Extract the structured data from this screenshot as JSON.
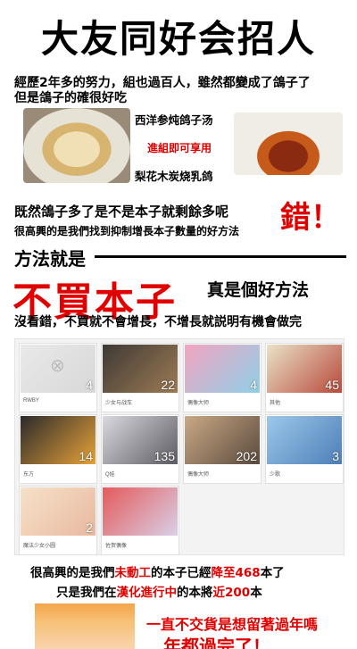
{
  "title": "大友同好会招人",
  "intro": {
    "line1": "經歷2年多的努力，組也過百人，雖然都變成了鴿子了",
    "line2": "但是鴿子的確很好吃"
  },
  "dishes": {
    "dish1": "西洋参炖鸽子汤",
    "offer": "進組即可享用",
    "dish2": "梨花木炭烧乳鸽"
  },
  "question": {
    "line1": "既然鴿子多了是不是本子就剩餘多呢",
    "line2": "很高興的是我們找到抑制增長本子數量的好方法",
    "answer": "錯！"
  },
  "method": {
    "label": "方法就是",
    "big": "不買本子",
    "comment": "真是個好方法"
  },
  "explain": "沒看錯，不買就不會增長，不增長就説明有機會做完",
  "collections": [
    {
      "label": "RWBY",
      "count": "4",
      "color_a": "#e9e9e9",
      "color_b": "#d8d8d8"
    },
    {
      "label": "少女与战车",
      "count": "22",
      "color_a": "#3e3a35",
      "color_b": "#9d7a55"
    },
    {
      "label": "偶像大师",
      "count": "4",
      "color_a": "#f3a4c0",
      "color_b": "#8fd0e8"
    },
    {
      "label": "其他",
      "count": "45",
      "color_a": "#e9e2c8",
      "color_b": "#b84a3a"
    },
    {
      "label": "东方",
      "count": "14",
      "color_a": "#2b2a2a",
      "color_b": "#e7a23a"
    },
    {
      "label": "Q娃",
      "count": "135",
      "color_a": "#d9d9df",
      "color_b": "#5d5b63"
    },
    {
      "label": "偶像大师",
      "count": "202",
      "color_a": "#c9a985",
      "color_b": "#5b4a3e"
    },
    {
      "label": "少歌",
      "count": "3",
      "color_a": "#9cc8ea",
      "color_b": "#4d7fb8"
    },
    {
      "label": "魔法少女小圆",
      "count": "2",
      "color_a": "#f6e1c9",
      "color_b": "#e8b9a0"
    },
    {
      "label": "佐贺偶像",
      "count": "",
      "color_a": "#e45b5b",
      "color_b": "#d9d0e8"
    }
  ],
  "status": {
    "l1_a": "很高興的是我們",
    "l1_b": "未動工",
    "l1_c": "的本子已經",
    "l1_d": "降至468",
    "l1_e": "本了",
    "l2_a": "只是我們在",
    "l2_b": "漢化進行中",
    "l2_c": "的本將",
    "l2_d": "近200",
    "l2_e": "本"
  },
  "footer": {
    "line1": "一直不交貨是想留著過年嗎",
    "line2": "年都過完了！"
  }
}
